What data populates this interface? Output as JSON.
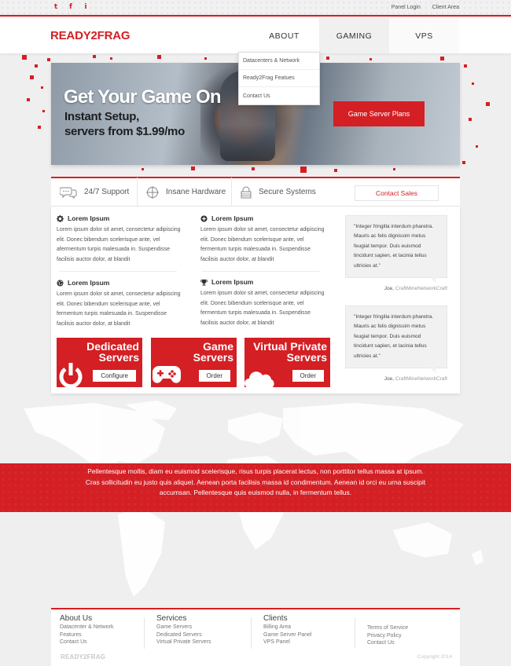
{
  "topbar": {
    "social": [
      {
        "icon": "twitter-icon",
        "glyph": "t"
      },
      {
        "icon": "facebook-icon",
        "glyph": "f"
      },
      {
        "icon": "info-icon",
        "glyph": "i"
      }
    ],
    "links": [
      "Panel Login",
      "Client Area"
    ]
  },
  "header": {
    "logo": "READY2FRAG",
    "nav": [
      "ABOUT",
      "GAMING",
      "VPS"
    ]
  },
  "dropdown": [
    "Datacenters & Network",
    "Ready2Frag Featues",
    "Contact Us"
  ],
  "hero": {
    "title": "Get Your Game On",
    "sub1": "Instant Setup,",
    "sub2": "servers from $1.99/mo",
    "button": "Game Server Plans"
  },
  "features": {
    "items": [
      {
        "icon": "chat-icon",
        "label": "24/7 Support"
      },
      {
        "icon": "crosshair-icon",
        "label": "Insane Hardware"
      },
      {
        "icon": "lock-icon",
        "label": "Secure Systems"
      }
    ],
    "contact": "Contact Sales"
  },
  "lorem": [
    {
      "icon": "gear-icon",
      "title": "Lorem Ipsum",
      "body": "Lorem ipsum dolor sit amet, consectetur adipiscing elit. Donec bibendum scelerisque ante, vel afermentum turpis malesuada in. Suspendisse facilisis auctor dolor, at blandit"
    },
    {
      "icon": "plus-circle-icon",
      "title": "Lorem Ipsum",
      "body": "Lorem ipsum dolor sit amet, consectetur adipiscing elit. Donec bibendum scelerisque ante, vel fermentum turpis malesuada in. Suspendisse facilisis auctor dolor, at blandit"
    },
    {
      "icon": "globe-icon",
      "title": "Lorem Ipsum",
      "body": "Lorem ipsum dolor sit amet, consectetur adipiscing elit. Donec bibendum scelerisque ante, vel fermentum turpis malesuada in. Suspendisse facilisis auctor dolor, at blandit"
    },
    {
      "icon": "trophy-icon",
      "title": "Lorem Ipsum",
      "body": "Lorem ipsum dolor sit amet, consectetur adipiscing elit. Donec bibendum scelerisque ante, vel fermentum turpis malesuada in. Suspendisse facilisis auctor dolor, at blandit"
    }
  ],
  "products": [
    {
      "title1": "Dedicated",
      "title2": "Servers",
      "button": "Configure",
      "icon": "power-icon"
    },
    {
      "title1": "Game",
      "title2": "Servers",
      "button": "Order",
      "icon": "gamepad-icon"
    },
    {
      "title1": "Virtual Private",
      "title2": "Servers",
      "button": "Order",
      "icon": "cloud-icon"
    }
  ],
  "quotes": [
    {
      "text": "\"Integer fringilla interdum pharetra. Mauris ac felis dignissim metus feugiat tempor. Duis euismod tincidunt sapien, et lacinia tellus ultricies at.\"",
      "author": "Joe,",
      "company": " CraftMineNetworkCraft"
    },
    {
      "text": "\"Integer fringilla interdum pharetra. Mauris ac felis dignissim metus feugiat tempor. Duis euismod tincidunt sapien, et lacinia tellus ultricies at.\"",
      "author": "Joe,",
      "company": " CraftMineNetworkCraft"
    }
  ],
  "band": "Pellentesque mollis, diam eu euismod scelerisque, risus turpis placerat lectus, non porttitor tellus massa at ipsum. Cras sollicitudin eu justo quis aliquet. Aenean porta facilisis massa id condimentum. Aenean id orci eu urna suscipit accumsan. Pellentesque quis euismod nulla, in fermentum tellus.",
  "footer": {
    "columns": [
      {
        "heading": "About Us",
        "links": [
          "Datacenter & Network",
          "Features",
          "Contact Us"
        ]
      },
      {
        "heading": "Services",
        "links": [
          "Game Servers",
          "Dedicated Servers",
          "Virtual Private Servers"
        ]
      },
      {
        "heading": "Clients",
        "links": [
          "Billing Area",
          "Game Server Panel",
          "VPS Panel"
        ]
      },
      {
        "heading": "",
        "links": [
          "Terms of Service",
          "Privacy Policy",
          "Contact Us"
        ]
      }
    ],
    "logo": "READY2FRAG",
    "copyright": "Copyright 2014"
  },
  "colors": {
    "accent": "#d41f24",
    "background": "#efefef"
  }
}
